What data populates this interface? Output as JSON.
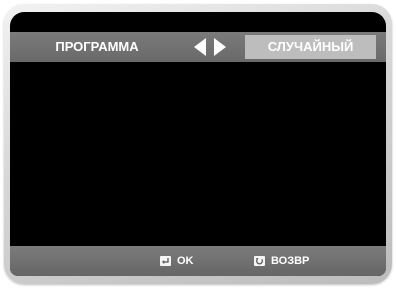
{
  "menu": {
    "setting_label": "ПРОГРАММА",
    "setting_value": "СЛУЧАЙНЫЙ",
    "arrow_left_icon": "triangle-left-icon",
    "arrow_right_icon": "triangle-right-icon"
  },
  "footer": {
    "ok_label": "OK",
    "ok_icon": "enter-key-icon",
    "back_label": "ВОЗВР",
    "back_icon": "return-key-icon"
  },
  "colors": {
    "bar": "#707070",
    "value_box": "#bdbdbd",
    "screen": "#000000",
    "text": "#ffffff"
  }
}
